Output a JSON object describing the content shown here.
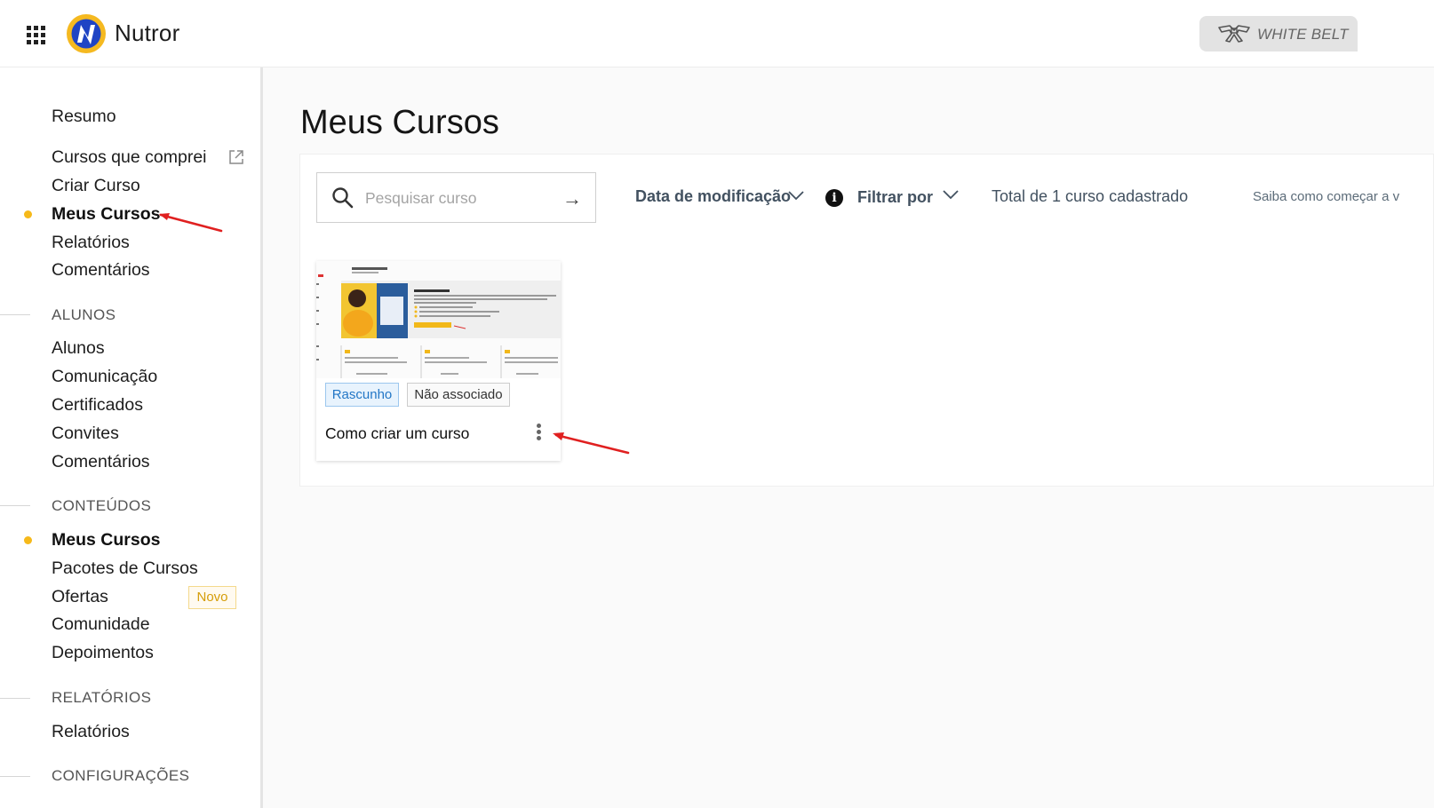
{
  "header": {
    "brand": "Nutror",
    "belt_label": "WHITE BELT",
    "icons": [
      "apps-grid-icon",
      "nutror-logo",
      "belt-icon"
    ]
  },
  "sidebar": {
    "items_top": [
      {
        "label": "Resumo",
        "active": false
      },
      {
        "label": "Cursos que comprei",
        "active": false,
        "icon": "external-link-icon"
      },
      {
        "label": "Criar Curso",
        "active": false
      },
      {
        "label": "Meus Cursos",
        "active": true
      },
      {
        "label": "Relatórios",
        "active": false
      },
      {
        "label": "Comentários",
        "active": false
      }
    ],
    "sections": [
      {
        "title": "ALUNOS",
        "items": [
          {
            "label": "Alunos"
          },
          {
            "label": "Comunicação"
          },
          {
            "label": "Certificados"
          },
          {
            "label": "Convites"
          },
          {
            "label": "Comentários"
          }
        ]
      },
      {
        "title": "CONTEÚDOS",
        "items": [
          {
            "label": "Meus Cursos",
            "active": true
          },
          {
            "label": "Pacotes de Cursos"
          },
          {
            "label": "Ofertas",
            "badge": "Novo"
          },
          {
            "label": "Comunidade"
          },
          {
            "label": "Depoimentos"
          }
        ]
      },
      {
        "title": "RELATÓRIOS",
        "items": [
          {
            "label": "Relatórios"
          }
        ]
      },
      {
        "title": "CONFIGURAÇÕES",
        "items": []
      }
    ],
    "accent_color": "#f6b91a"
  },
  "main": {
    "title": "Meus Cursos",
    "search": {
      "placeholder": "Pesquisar curso",
      "value": ""
    },
    "sort_label": "Data de modificação",
    "filter_label": "Filtrar por",
    "total_text": "Total de 1 curso cadastrado",
    "help_text": "Saiba como começar a v",
    "courses": [
      {
        "title": "Como criar um curso",
        "status": "Rascunho",
        "association": "Não associado"
      }
    ]
  },
  "annotations": {
    "arrow_color": "#e02020"
  }
}
